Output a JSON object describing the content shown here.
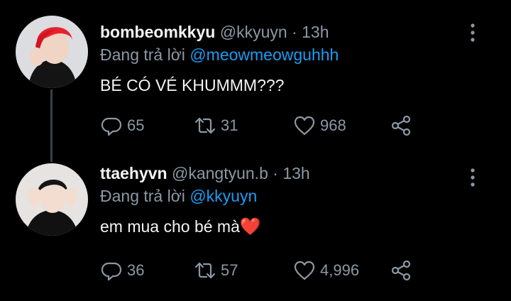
{
  "tweets": [
    {
      "name": "bombeomkkyu",
      "handle": "@kkyuyn",
      "time": "13h",
      "reply_prefix": "Đang trả lời",
      "reply_to": "@meowmeowguhhh",
      "text": "BÉ CÓ VÉ KHUMMM???",
      "replies": "65",
      "retweets": "31",
      "likes": "968"
    },
    {
      "name": "ttaehyvn",
      "handle": "@kangtyun.b",
      "time": "13h",
      "reply_prefix": "Đang trả lời",
      "reply_to": "@kkyuyn",
      "text": "em mua cho bé mà",
      "emoji": "❤️",
      "replies": "36",
      "retweets": "57",
      "likes": "4,996"
    }
  ],
  "separator": "·",
  "icons": [
    "reply-icon",
    "retweet-icon",
    "like-icon",
    "share-icon",
    "more-icon"
  ],
  "colors": {
    "background": "#000000",
    "secondary_text": "#8b98a5",
    "mention": "#1d9bf0",
    "heart": "#e0102a"
  }
}
